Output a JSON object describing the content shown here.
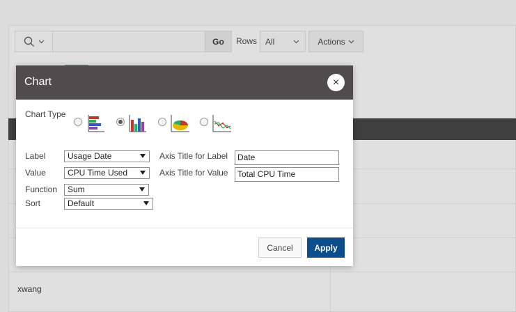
{
  "toolbar": {
    "search_icon": "search-icon",
    "go_label": "Go",
    "rows_label": "Rows",
    "rows_value": "All",
    "actions_label": "Actions"
  },
  "report": {
    "cell_value": "xwang"
  },
  "dialog": {
    "title": "Chart",
    "close_glyph": "×",
    "chart_type_label": "Chart Type",
    "chart_types": [
      {
        "icon": "horizontal-bar-chart-icon",
        "selected": false
      },
      {
        "icon": "vertical-bar-chart-icon",
        "selected": true
      },
      {
        "icon": "pie-chart-icon",
        "selected": false
      },
      {
        "icon": "line-chart-icon",
        "selected": false
      }
    ],
    "label_label": "Label",
    "label_value": "Usage Date",
    "value_label": "Value",
    "value_value": "CPU Time Used",
    "function_label": "Function",
    "function_value": "Sum",
    "sort_label": "Sort",
    "sort_value": "Default",
    "axis_label_title": "Axis Title for Label",
    "axis_label_value": "Date",
    "axis_value_title": "Axis Title for Value",
    "axis_value_value": "Total CPU Time",
    "cancel_label": "Cancel",
    "apply_label": "Apply"
  },
  "colors": {
    "header_bg": "#4e4c4c",
    "apply_bg": "#0c4d8c"
  }
}
